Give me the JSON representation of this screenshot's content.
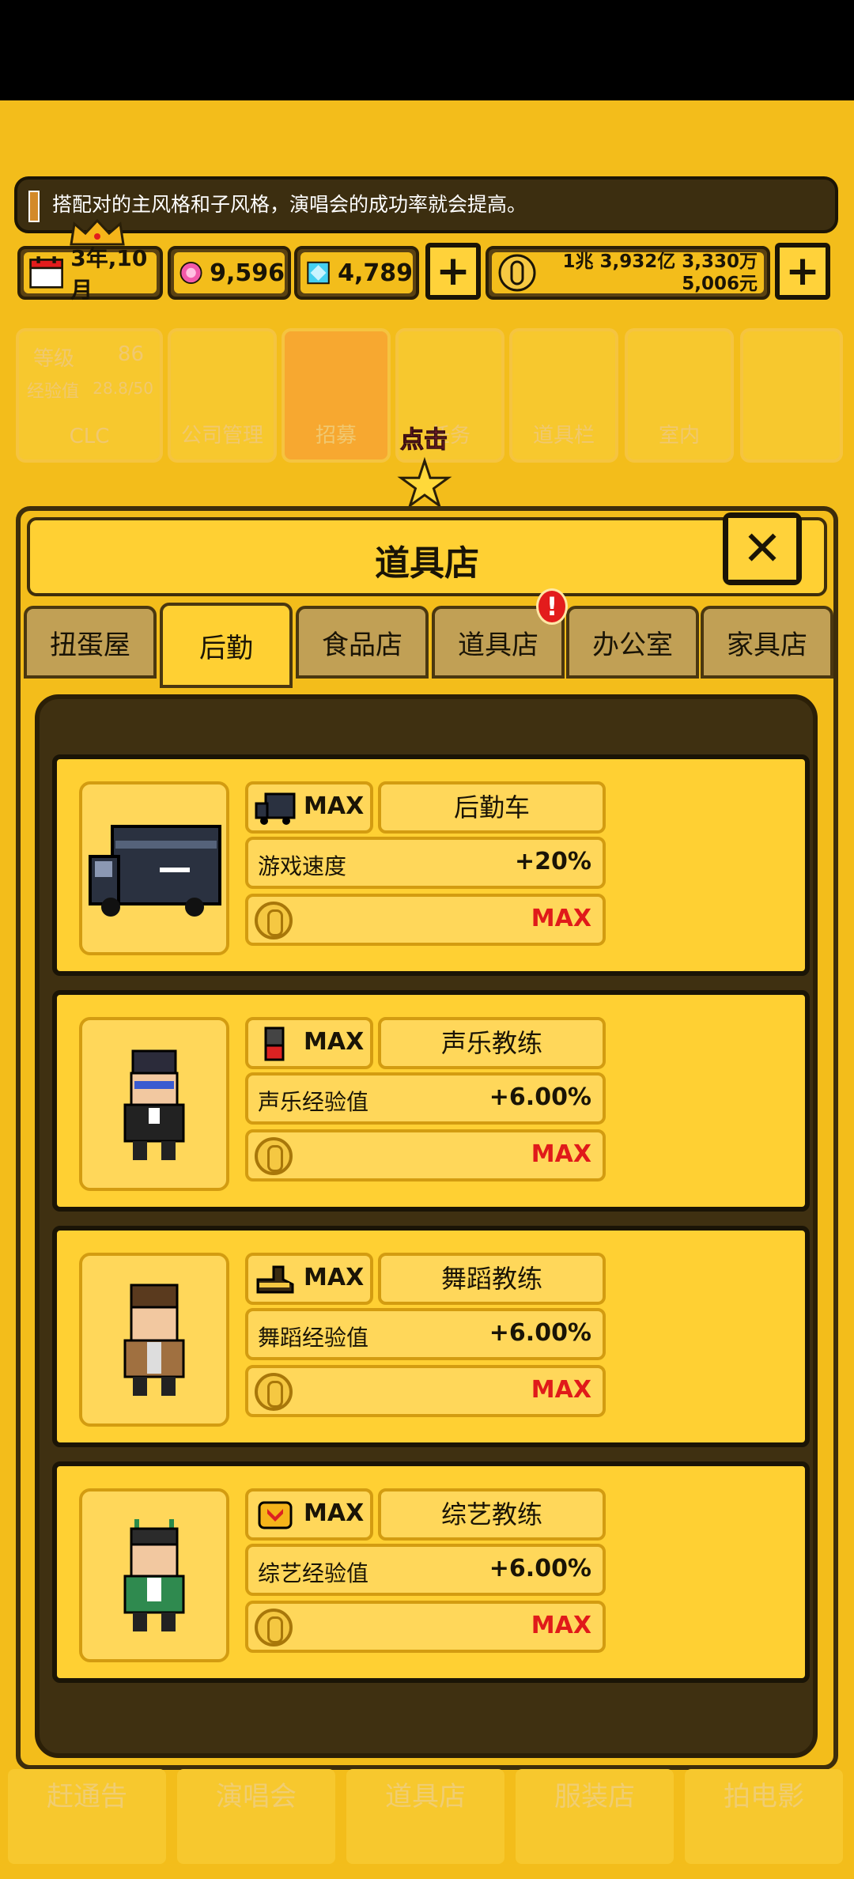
{
  "tip": {
    "text": "搭配对的主风格和子风格，演唱会的成功率就会提高。"
  },
  "resources": {
    "date": "3年,10月",
    "pink_gems": "9,596",
    "blue_gems": "4,789",
    "money_line1": "1兆 3,932亿 3,330万",
    "money_line2": "5,006元"
  },
  "background_tiles": {
    "level_label": "等级",
    "level_value": "86",
    "exp_label": "经验值",
    "exp_value": "28.8/50",
    "company": "CLC",
    "company_mgmt": "公司管理",
    "recruit": "招募",
    "task": "任务",
    "inventory": "道具栏",
    "interior": "室内"
  },
  "hint": {
    "tap": "点击"
  },
  "shop": {
    "title": "道具店",
    "tabs": [
      {
        "label": "扭蛋屋",
        "active": false
      },
      {
        "label": "后勤",
        "active": true
      },
      {
        "label": "食品店",
        "active": false
      },
      {
        "label": "道具店",
        "active": false,
        "alert": "!"
      },
      {
        "label": "办公室",
        "active": false
      },
      {
        "label": "家具店",
        "active": false
      }
    ],
    "items": [
      {
        "level": "MAX",
        "name": "后勤车",
        "stat_label": "游戏速度",
        "stat_value": "+20%",
        "cost": "MAX",
        "icon": "van-icon"
      },
      {
        "level": "MAX",
        "name": "声乐教练",
        "stat_label": "声乐经验值",
        "stat_value": "+6.00%",
        "cost": "MAX",
        "icon": "microphone-icon"
      },
      {
        "level": "MAX",
        "name": "舞蹈教练",
        "stat_label": "舞蹈经验值",
        "stat_value": "+6.00%",
        "cost": "MAX",
        "icon": "shoe-icon"
      },
      {
        "level": "MAX",
        "name": "综艺教练",
        "stat_label": "综艺经验值",
        "stat_value": "+6.00%",
        "cost": "MAX",
        "icon": "badge-icon"
      }
    ]
  },
  "bottom_nav": {
    "items": [
      "赶通告",
      "演唱会",
      "道具店",
      "服装店",
      "拍电影"
    ]
  },
  "colors": {
    "gold": "#f3bd1b",
    "dark": "#3f3011",
    "max_red": "#e01a1a"
  }
}
